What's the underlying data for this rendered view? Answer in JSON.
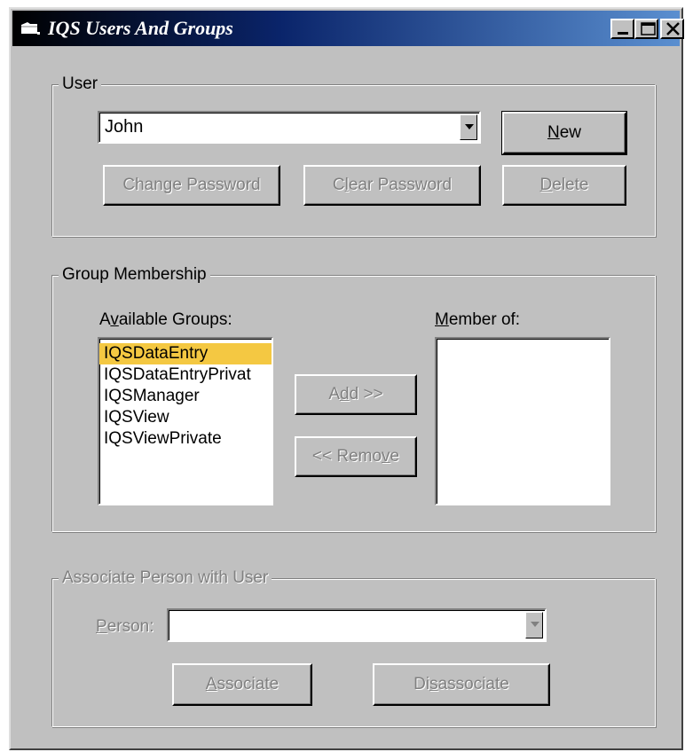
{
  "window": {
    "title": "IQS Users And Groups",
    "title_icon": "folder-icon",
    "controls": [
      "minimize-icon",
      "maximize-icon",
      "close-icon"
    ]
  },
  "user_group": {
    "legend": "User",
    "user_combo_value": "John",
    "new_button": {
      "pre": "",
      "ul": "N",
      "post": "ew"
    },
    "change_password_button": {
      "pre": "Chan",
      "ul": "g",
      "post": "e Password"
    },
    "clear_password_button": {
      "pre": "C",
      "ul": "l",
      "post": "ear Password"
    },
    "delete_button": {
      "pre": "",
      "ul": "D",
      "post": "elete"
    }
  },
  "group_membership": {
    "legend": "Group Membership",
    "available_label": {
      "pre": "A",
      "ul": "v",
      "post": "ailable Groups:"
    },
    "member_label": {
      "pre": "",
      "ul": "M",
      "post": "ember of:"
    },
    "available_groups": [
      "IQSDataEntry",
      "IQSDataEntryPrivat",
      "IQSManager",
      "IQSView",
      "IQSViewPrivate"
    ],
    "selected_group": "IQSDataEntry",
    "member_of": [],
    "add_button": {
      "pre": "A",
      "ul": "d",
      "post": "d >>"
    },
    "remove_button": {
      "pre": "<< Remo",
      "ul": "v",
      "post": "e"
    }
  },
  "associate": {
    "legend": "Associate Person with User",
    "person_label": {
      "pre": "",
      "ul": "P",
      "post": "erson:"
    },
    "person_value": "",
    "associate_button": {
      "pre": "",
      "ul": "A",
      "post": "ssociate"
    },
    "disassociate_button": {
      "pre": "Di",
      "ul": "s",
      "post": "associate"
    }
  },
  "colors": {
    "face": "#c0c0c0",
    "selection": "#f4c842",
    "title_gradient_start": "#000000",
    "title_gradient_end": "#5a8fd0"
  }
}
